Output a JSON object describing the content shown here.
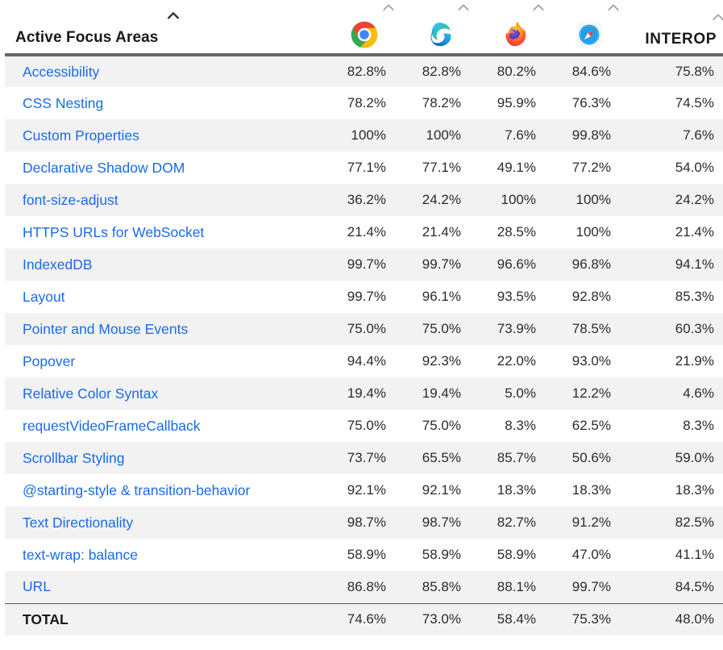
{
  "table": {
    "header": {
      "feature_column_label": "Active Focus Areas",
      "interop_column_label": "INTEROP",
      "sort_indicator": "chevron-up-icon",
      "browsers": [
        {
          "key": "chrome",
          "name": "Chrome",
          "icon": "chrome-icon"
        },
        {
          "key": "edge",
          "name": "Edge",
          "icon": "edge-icon"
        },
        {
          "key": "firefox",
          "name": "Firefox",
          "icon": "firefox-icon"
        },
        {
          "key": "safari",
          "name": "Safari",
          "icon": "safari-icon"
        }
      ]
    },
    "rows": [
      {
        "feature": "Accessibility",
        "chrome": "82.8%",
        "edge": "82.8%",
        "firefox": "80.2%",
        "safari": "84.6%",
        "interop": "75.8%"
      },
      {
        "feature": "CSS Nesting",
        "chrome": "78.2%",
        "edge": "78.2%",
        "firefox": "95.9%",
        "safari": "76.3%",
        "interop": "74.5%"
      },
      {
        "feature": "Custom Properties",
        "chrome": "100%",
        "edge": "100%",
        "firefox": "7.6%",
        "safari": "99.8%",
        "interop": "7.6%"
      },
      {
        "feature": "Declarative Shadow DOM",
        "chrome": "77.1%",
        "edge": "77.1%",
        "firefox": "49.1%",
        "safari": "77.2%",
        "interop": "54.0%"
      },
      {
        "feature": "font-size-adjust",
        "chrome": "36.2%",
        "edge": "24.2%",
        "firefox": "100%",
        "safari": "100%",
        "interop": "24.2%"
      },
      {
        "feature": "HTTPS URLs for WebSocket",
        "chrome": "21.4%",
        "edge": "21.4%",
        "firefox": "28.5%",
        "safari": "100%",
        "interop": "21.4%"
      },
      {
        "feature": "IndexedDB",
        "chrome": "99.7%",
        "edge": "99.7%",
        "firefox": "96.6%",
        "safari": "96.8%",
        "interop": "94.1%"
      },
      {
        "feature": "Layout",
        "chrome": "99.7%",
        "edge": "96.1%",
        "firefox": "93.5%",
        "safari": "92.8%",
        "interop": "85.3%"
      },
      {
        "feature": "Pointer and Mouse Events",
        "chrome": "75.0%",
        "edge": "75.0%",
        "firefox": "73.9%",
        "safari": "78.5%",
        "interop": "60.3%"
      },
      {
        "feature": "Popover",
        "chrome": "94.4%",
        "edge": "92.3%",
        "firefox": "22.0%",
        "safari": "93.0%",
        "interop": "21.9%"
      },
      {
        "feature": "Relative Color Syntax",
        "chrome": "19.4%",
        "edge": "19.4%",
        "firefox": "5.0%",
        "safari": "12.2%",
        "interop": "4.6%"
      },
      {
        "feature": "requestVideoFrameCallback",
        "chrome": "75.0%",
        "edge": "75.0%",
        "firefox": "8.3%",
        "safari": "62.5%",
        "interop": "8.3%"
      },
      {
        "feature": "Scrollbar Styling",
        "chrome": "73.7%",
        "edge": "65.5%",
        "firefox": "85.7%",
        "safari": "50.6%",
        "interop": "59.0%"
      },
      {
        "feature": "@starting-style & transition-behavior",
        "chrome": "92.1%",
        "edge": "92.1%",
        "firefox": "18.3%",
        "safari": "18.3%",
        "interop": "18.3%"
      },
      {
        "feature": "Text Directionality",
        "chrome": "98.7%",
        "edge": "98.7%",
        "firefox": "82.7%",
        "safari": "91.2%",
        "interop": "82.5%"
      },
      {
        "feature": "text-wrap: balance",
        "chrome": "58.9%",
        "edge": "58.9%",
        "firefox": "58.9%",
        "safari": "47.0%",
        "interop": "41.1%"
      },
      {
        "feature": "URL",
        "chrome": "86.8%",
        "edge": "85.8%",
        "firefox": "88.1%",
        "safari": "99.7%",
        "interop": "84.5%"
      }
    ],
    "total_row": {
      "label": "TOTAL",
      "chrome": "74.6%",
      "edge": "73.0%",
      "firefox": "58.4%",
      "safari": "75.3%",
      "interop": "48.0%"
    }
  },
  "colors": {
    "link": "#1a6ae8",
    "text": "#2b2b2b",
    "header_text": "#1a1a1a",
    "row_alt_background": "#f2f2f2",
    "row_background": "#ffffff",
    "header_rule": "#666666",
    "total_rule": "#555555"
  },
  "chart_data": {
    "type": "table",
    "title": "Active Focus Areas",
    "columns": [
      "Active Focus Areas",
      "Chrome",
      "Edge",
      "Firefox",
      "Safari",
      "INTEROP"
    ],
    "categories": [
      "Accessibility",
      "CSS Nesting",
      "Custom Properties",
      "Declarative Shadow DOM",
      "font-size-adjust",
      "HTTPS URLs for WebSocket",
      "IndexedDB",
      "Layout",
      "Pointer and Mouse Events",
      "Popover",
      "Relative Color Syntax",
      "requestVideoFrameCallback",
      "Scrollbar Styling",
      "@starting-style & transition-behavior",
      "Text Directionality",
      "text-wrap: balance",
      "URL"
    ],
    "series": [
      {
        "name": "Chrome",
        "values": [
          82.8,
          78.2,
          100,
          77.1,
          36.2,
          21.4,
          99.7,
          99.7,
          75.0,
          94.4,
          19.4,
          75.0,
          73.7,
          92.1,
          98.7,
          58.9,
          86.8
        ],
        "total": 74.6
      },
      {
        "name": "Edge",
        "values": [
          82.8,
          78.2,
          100,
          77.1,
          24.2,
          21.4,
          99.7,
          96.1,
          75.0,
          92.3,
          19.4,
          75.0,
          65.5,
          92.1,
          98.7,
          58.9,
          85.8
        ],
        "total": 73.0
      },
      {
        "name": "Firefox",
        "values": [
          80.2,
          95.9,
          7.6,
          49.1,
          100,
          28.5,
          96.6,
          93.5,
          73.9,
          22.0,
          5.0,
          8.3,
          85.7,
          18.3,
          82.7,
          58.9,
          88.1
        ],
        "total": 58.4
      },
      {
        "name": "Safari",
        "values": [
          84.6,
          76.3,
          99.8,
          77.2,
          100,
          100,
          96.8,
          92.8,
          78.5,
          93.0,
          12.2,
          62.5,
          50.6,
          18.3,
          91.2,
          47.0,
          99.7
        ],
        "total": 75.3
      },
      {
        "name": "INTEROP",
        "values": [
          75.8,
          74.5,
          7.6,
          54.0,
          24.2,
          21.4,
          94.1,
          85.3,
          60.3,
          21.9,
          4.6,
          8.3,
          59.0,
          18.3,
          82.5,
          41.1,
          84.5
        ],
        "total": 48.0
      }
    ],
    "units": "percent",
    "ylim": [
      0,
      100
    ]
  }
}
